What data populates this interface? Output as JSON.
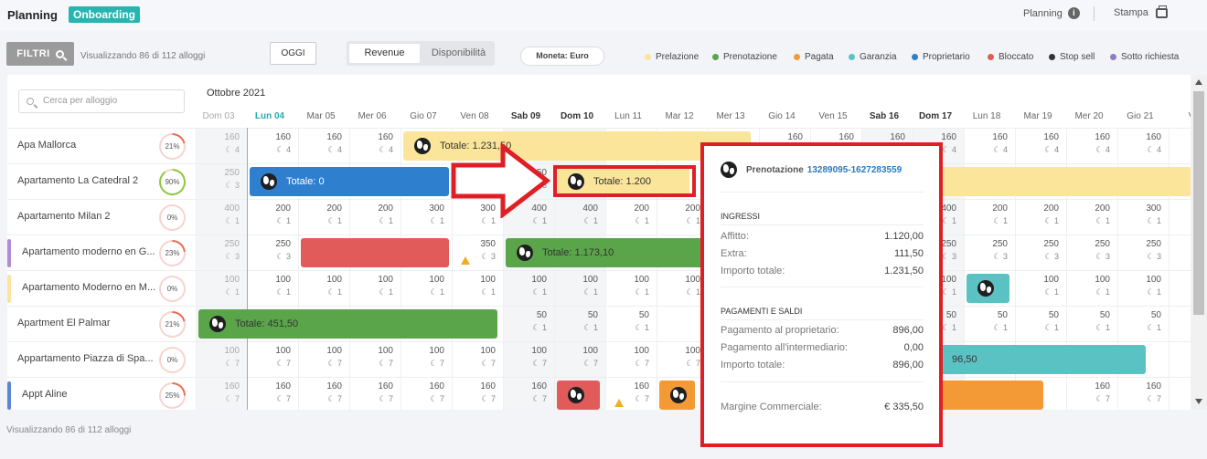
{
  "header": {
    "brand": "Planning",
    "badge": "Onboarding",
    "right_planning": "Planning",
    "right_stampa": "Stampa"
  },
  "toolbar": {
    "filtri": "FILTRI",
    "showing": "Visualizzando 86 di 112 alloggi",
    "today_button": "OGGI",
    "view_revenue": "Revenue",
    "view_availability": "Disponibilità",
    "currency": "Moneta: Euro"
  },
  "legend": [
    {
      "label": "Prelazione",
      "color": "#fbe59a"
    },
    {
      "label": "Prenotazione",
      "color": "#5aa54a"
    },
    {
      "label": "Pagata",
      "color": "#f39a37"
    },
    {
      "label": "Garanzia",
      "color": "#5bc2c3"
    },
    {
      "label": "Proprietario",
      "color": "#2f7fcf"
    },
    {
      "label": "Bloccato",
      "color": "#e15b5b"
    },
    {
      "label": "Stop sell",
      "color": "#333333"
    },
    {
      "label": "Sotto richiesta",
      "color": "#8e7cc3"
    }
  ],
  "search": {
    "placeholder": "Cerca per alloggio"
  },
  "properties": [
    {
      "name": "Apa Mallorca",
      "pct": "21%",
      "occ": 21,
      "ring": "#e96b55",
      "bar": ""
    },
    {
      "name": "Apartamento La Catedral 2",
      "pct": "90%",
      "occ": 90,
      "ring": "#8cc63f",
      "bar": ""
    },
    {
      "name": "Apartamento Milan 2",
      "pct": "0%",
      "occ": 0,
      "ring": "#e96b55",
      "bar": ""
    },
    {
      "name": "Apartamento moderno en G...",
      "pct": "23%",
      "occ": 23,
      "ring": "#e96b55",
      "bar": "#b48bd6"
    },
    {
      "name": "Apartamento Moderno en M...",
      "pct": "0%",
      "occ": 0,
      "ring": "#e96b55",
      "bar": "#fbe59a"
    },
    {
      "name": "Apartment El Palmar",
      "pct": "21%",
      "occ": 21,
      "ring": "#e96b55",
      "bar": ""
    },
    {
      "name": "Appartamento Piazza di Spa...",
      "pct": "0%",
      "occ": 0,
      "ring": "#e96b55",
      "bar": ""
    },
    {
      "name": "Appt Aline",
      "pct": "25%",
      "occ": 25,
      "ring": "#e96b55",
      "bar": "#5b86d6"
    }
  ],
  "calendar": {
    "month": "Ottobre 2021",
    "days": [
      {
        "label": "Dom 03",
        "we": true,
        "dim": true
      },
      {
        "label": "Lun 04",
        "today": true
      },
      {
        "label": "Mar 05"
      },
      {
        "label": "Mer 06"
      },
      {
        "label": "Gio 07"
      },
      {
        "label": "Ven 08"
      },
      {
        "label": "Sab 09",
        "we": true
      },
      {
        "label": "Dom 10",
        "we": true
      },
      {
        "label": "Lun 11"
      },
      {
        "label": "Mar 12"
      },
      {
        "label": "Mer 13"
      },
      {
        "label": "Gio 14"
      },
      {
        "label": "Ven 15"
      },
      {
        "label": "Sab 16",
        "we": true
      },
      {
        "label": "Dom 17",
        "we": true
      },
      {
        "label": "Lun 18"
      },
      {
        "label": "Mar 19"
      },
      {
        "label": "Mer 20"
      },
      {
        "label": "Gio 21"
      },
      {
        "label": "V"
      }
    ],
    "rows": [
      {
        "prices": [
          "160",
          "160",
          "160",
          "160",
          "",
          "",
          "",
          "",
          "",
          "",
          "",
          "160",
          "160",
          "160",
          "160",
          "160",
          "160",
          "160",
          "160"
        ],
        "nights": [
          "4",
          "4",
          "4",
          "4",
          "",
          "",
          "",
          "",
          "",
          "",
          "",
          "4",
          "4",
          "4",
          "4",
          "4",
          "4",
          "4",
          "4"
        ]
      },
      {
        "prices": [
          "250",
          "",
          "",
          "",
          "",
          "",
          "250",
          "",
          "",
          "",
          "",
          "",
          "",
          "",
          "",
          "",
          "",
          "",
          ""
        ],
        "nights": [
          "3",
          "",
          "",
          "",
          "",
          "",
          "3",
          "",
          "",
          "",
          "",
          "",
          "",
          "",
          "",
          "",
          "",
          "",
          ""
        ]
      },
      {
        "prices": [
          "400",
          "200",
          "200",
          "200",
          "300",
          "300",
          "400",
          "400",
          "200",
          "200",
          "",
          "",
          "",
          "",
          "400",
          "200",
          "200",
          "200",
          "300"
        ],
        "nights": [
          "1",
          "1",
          "1",
          "1",
          "1",
          "1",
          "1",
          "1",
          "1",
          "1",
          "",
          "",
          "",
          "",
          "1",
          "1",
          "1",
          "1",
          "1"
        ]
      },
      {
        "prices": [
          "250",
          "250",
          "",
          "",
          "",
          "350",
          "",
          "",
          "",
          "",
          "",
          "",
          "",
          "",
          "250",
          "250",
          "250",
          "250",
          "250"
        ],
        "nights": [
          "3",
          "3",
          "",
          "",
          "",
          "3",
          "",
          "",
          "",
          "",
          "",
          "",
          "",
          "",
          "3",
          "3",
          "3",
          "3",
          "3"
        ]
      },
      {
        "prices": [
          "100",
          "100",
          "100",
          "100",
          "100",
          "100",
          "100",
          "100",
          "100",
          "100",
          "",
          "",
          "",
          "",
          "100",
          "",
          "100",
          "100",
          "100"
        ],
        "nights": [
          "1",
          "1",
          "1",
          "1",
          "1",
          "1",
          "1",
          "1",
          "1",
          "1",
          "",
          "",
          "",
          "",
          "1",
          "",
          "1",
          "1",
          "1"
        ]
      },
      {
        "prices": [
          "",
          "",
          "",
          "",
          "",
          "",
          "50",
          "50",
          "50",
          "",
          "",
          "",
          "",
          "",
          "50",
          "50",
          "50",
          "50",
          "50"
        ],
        "nights": [
          "",
          "",
          "",
          "",
          "",
          "",
          "1",
          "1",
          "1",
          "",
          "",
          "",
          "",
          "",
          "1",
          "1",
          "1",
          "1",
          "1"
        ]
      },
      {
        "prices": [
          "100",
          "100",
          "100",
          "100",
          "100",
          "100",
          "100",
          "100",
          "100",
          "100",
          "",
          "",
          "",
          "",
          "",
          "",
          "",
          "",
          ""
        ],
        "nights": [
          "7",
          "7",
          "7",
          "7",
          "7",
          "7",
          "7",
          "7",
          "7",
          "7",
          "",
          "",
          "",
          "",
          "",
          "",
          "",
          "",
          ""
        ]
      },
      {
        "prices": [
          "160",
          "160",
          "160",
          "160",
          "160",
          "160",
          "160",
          "",
          "160",
          "",
          "",
          "",
          "",
          "",
          "",
          "",
          "",
          "160",
          "160"
        ],
        "nights": [
          "7",
          "7",
          "7",
          "7",
          "7",
          "7",
          "7",
          "",
          "7",
          "",
          "",
          "",
          "",
          "",
          "",
          "",
          "",
          "7",
          "7"
        ]
      }
    ],
    "bookings": [
      {
        "row": 0,
        "start": 4,
        "span": 6.9,
        "status": "Prelazione",
        "label": "Totale: 1.231,50"
      },
      {
        "row": 1,
        "start": 1,
        "span": 4.0,
        "status": "Proprietario",
        "label": "Totale: 0"
      },
      {
        "row": 1,
        "start": 7,
        "span": 2.7,
        "status": "Prelazione",
        "label": "Totale: 1.200"
      },
      {
        "row": 1,
        "start": 14,
        "span": 5.5,
        "status": "Prelazione",
        "label": ""
      },
      {
        "row": 3,
        "start": 2,
        "span": 3.0,
        "status": "Bloccato",
        "label": ""
      },
      {
        "row": 3,
        "start": 6,
        "span": 4.5,
        "status": "Prenotazione",
        "label": "Totale: 1.173,10"
      },
      {
        "row": 4,
        "start": 15,
        "span": 0.95,
        "status": "Garanzia",
        "label": ""
      },
      {
        "row": 5,
        "start": 0,
        "span": 5.95,
        "status": "Prenotazione",
        "label": "Totale: 451,50"
      },
      {
        "row": 6,
        "start": 14,
        "span": 4.6,
        "status": "Garanzia",
        "label": "96,50"
      },
      {
        "row": 7,
        "start": 7,
        "span": 0.95,
        "status": "Bloccato",
        "label": ""
      },
      {
        "row": 7,
        "start": 9,
        "span": 0.8,
        "status": "Pagata",
        "label": ""
      },
      {
        "row": 7,
        "start": 14,
        "span": 2.6,
        "status": "Pagata",
        "label": ""
      }
    ],
    "warnings": [
      {
        "row": 3,
        "col": 5
      },
      {
        "row": 7,
        "col": 8
      }
    ]
  },
  "footer": {
    "showing": "Visualizzando 86 di 112 alloggi"
  },
  "popup": {
    "type_label": "Prenotazione",
    "code": "13289095-1627283559",
    "ingressi_title": "INGRESSI",
    "ingressi": [
      {
        "label": "Affitto:",
        "value": "1.120,00"
      },
      {
        "label": "Extra:",
        "value": "111,50"
      },
      {
        "label": "Importo totale:",
        "value": "1.231,50"
      }
    ],
    "pagamenti_title": "PAGAMENTI E SALDI",
    "pagamenti": [
      {
        "label": "Pagamento al proprietario:",
        "value": "896,00"
      },
      {
        "label": "Pagamento all'intermediario:",
        "value": "0,00"
      },
      {
        "label": "Importo totale:",
        "value": "896,00"
      }
    ],
    "margine_label": "Margine Commerciale:",
    "margine_value": "€ 335,50"
  }
}
